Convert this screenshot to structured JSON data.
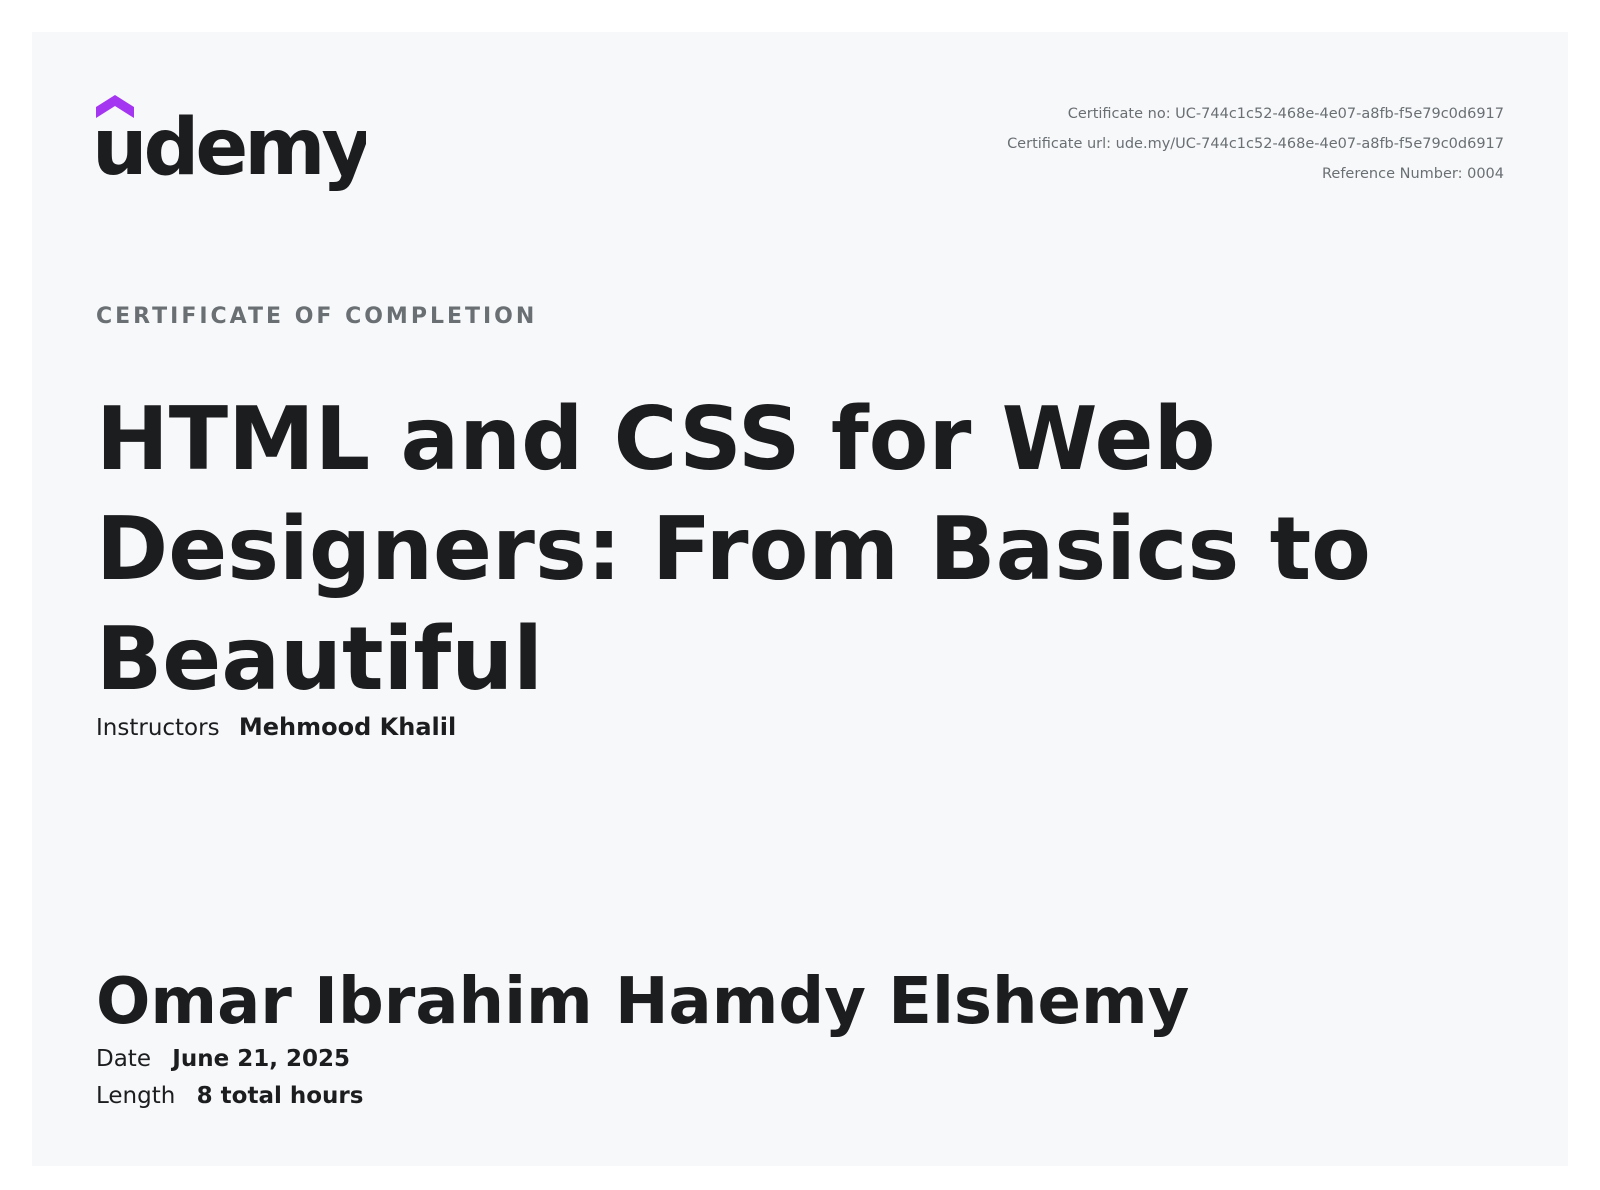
{
  "brand": {
    "logo_text": "udemy",
    "logo_accent_color": "#a435f0",
    "logo_text_color": "#1c1d1f"
  },
  "meta": {
    "certificate_no": "Certificate no: UC-744c1c52-468e-4e07-a8fb-f5e79c0d6917",
    "certificate_url": "Certificate url: ude.my/UC-744c1c52-468e-4e07-a8fb-f5e79c0d6917",
    "reference_number": "Reference Number: 0004"
  },
  "certificate": {
    "eyebrow": "CERTIFICATE OF COMPLETION",
    "course_title": "HTML and CSS for Web Designers: From Basics to Beautiful",
    "instructors_label": "Instructors",
    "instructors_value": "Mehmood Khalil",
    "student_name": "Omar Ibrahim Hamdy Elshemy",
    "date_label": "Date",
    "date_value": "June 21, 2025",
    "length_label": "Length",
    "length_value": "8 total hours"
  },
  "colors": {
    "page_background": "#f7f8fa",
    "text_primary": "#1c1d1f",
    "text_secondary": "#6a6f73"
  }
}
